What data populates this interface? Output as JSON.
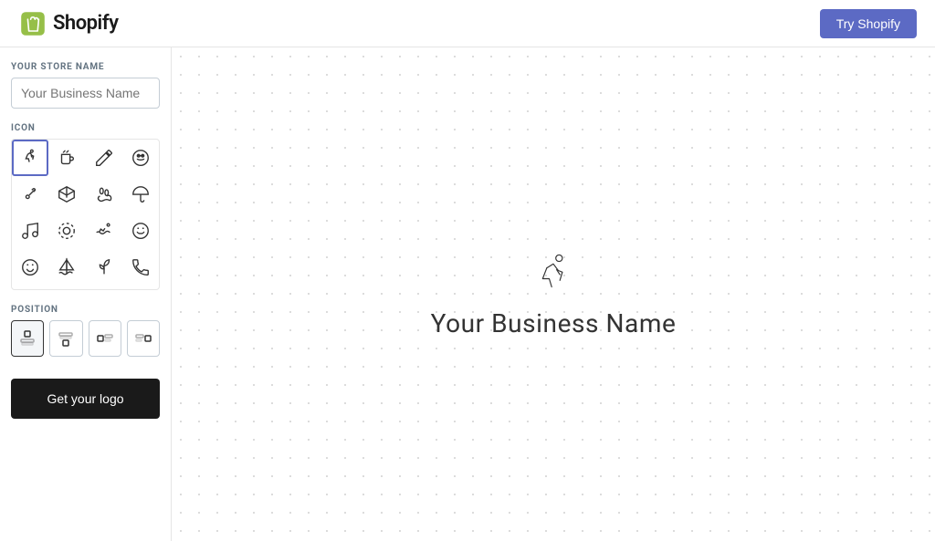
{
  "header": {
    "logo_alt": "Shopify",
    "try_button_label": "Try Shopify"
  },
  "sidebar": {
    "store_name_label": "YOUR STORE NAME",
    "store_name_placeholder": "Your Business Name",
    "store_name_value": "",
    "icon_label": "ICON",
    "position_label": "POSITION",
    "get_logo_label": "Get your logo",
    "icons": [
      {
        "id": "runner",
        "label": "Runner",
        "selected": true
      },
      {
        "id": "coffee",
        "label": "Coffee Cup"
      },
      {
        "id": "pencil",
        "label": "Pencil"
      },
      {
        "id": "smiley-glasses",
        "label": "Smiley with Glasses"
      },
      {
        "id": "guitar",
        "label": "Guitar"
      },
      {
        "id": "box",
        "label": "Box"
      },
      {
        "id": "footprint",
        "label": "Footprint"
      },
      {
        "id": "umbrella",
        "label": "Umbrella"
      },
      {
        "id": "music",
        "label": "Music Note"
      },
      {
        "id": "circle-dashed",
        "label": "Circle Dashed"
      },
      {
        "id": "swim",
        "label": "Swimmer"
      },
      {
        "id": "laugh",
        "label": "Laugh Emoji"
      },
      {
        "id": "smiley",
        "label": "Smiley"
      },
      {
        "id": "sailboat",
        "label": "Sailboat"
      },
      {
        "id": "plant",
        "label": "Plant"
      },
      {
        "id": "telephone",
        "label": "Telephone"
      }
    ],
    "positions": [
      {
        "id": "icon-top",
        "label": "Icon Top",
        "active": true
      },
      {
        "id": "icon-bottom",
        "label": "Icon Bottom"
      },
      {
        "id": "icon-left",
        "label": "Icon Left"
      },
      {
        "id": "icon-right",
        "label": "Icon Right"
      }
    ]
  },
  "preview": {
    "business_name": "Your Business Name"
  }
}
